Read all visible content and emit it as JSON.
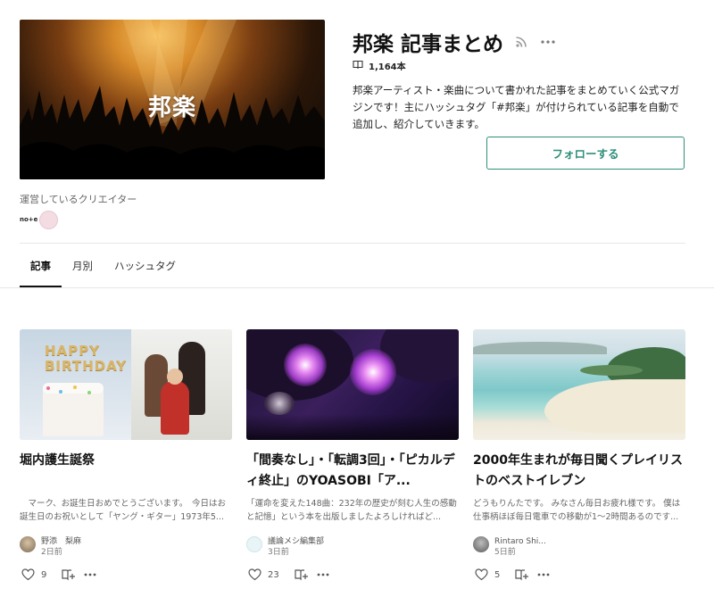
{
  "magazine": {
    "banner_text": "邦楽",
    "title": "邦楽 記事まとめ",
    "article_count": "1,164本",
    "description": "邦楽アーティスト・楽曲について書かれた記事をまとめていく公式マガジンです！主にハッシュタグ「#邦楽」が付けられている記事を自動で追加し、紹介していきます。",
    "follow_label": "フォローする",
    "creator_label": "運営しているクリエイター",
    "creator_logo": "no+e"
  },
  "tabs": [
    {
      "label": "記事"
    },
    {
      "label": "月別"
    },
    {
      "label": "ハッシュタグ"
    }
  ],
  "cards": [
    {
      "title": "堀内護生誕祭",
      "excerpt": "　マーク、お誕生日おめでとうございます。　今日はお誕生日のお祝いとして「ヤング・ギター」1973年5...",
      "author": "野添　梨麻",
      "date": "2日前",
      "likes": "9"
    },
    {
      "title": "「間奏なし」・「転調3回」・「ピカルディ終止」のYOASOBI「ア...",
      "excerpt": "「運命を変えた148曲：232年の歴史が刻む人生の感動と記憶」という本を出版しましたよろしければど...",
      "author": "議論メシ編集部",
      "date": "3日前",
      "likes": "23"
    },
    {
      "title": "2000年生まれが毎日聞くプレイリストのベストイレブン",
      "excerpt": "どうもりんたです。 みなさん毎日お疲れ様です。 僕は仕事柄ほぼ毎日電車での移動が1〜2時間あるのです...",
      "author": "Rintaro Shi...",
      "date": "5日前",
      "likes": "5"
    }
  ],
  "icons": {
    "rss": "rss-icon",
    "more": "more-icon",
    "book": "book-icon",
    "heart": "heart-icon",
    "magazine_add": "magazine-add-icon"
  },
  "colors": {
    "accent": "#2e8f7a"
  }
}
